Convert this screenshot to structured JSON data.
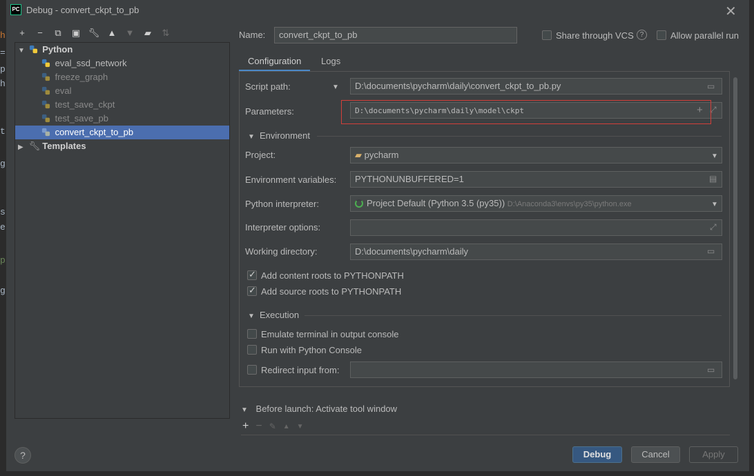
{
  "window": {
    "title": "Debug - convert_ckpt_to_pb",
    "logo_text": "PC"
  },
  "toolbar": {
    "icons": [
      "add-icon",
      "remove-icon",
      "copy-icon",
      "save-icon",
      "wrench-icon",
      "move-up-icon",
      "move-down-icon",
      "folder-icon",
      "sort-icon"
    ]
  },
  "tree": {
    "python_label": "Python",
    "items": [
      "eval_ssd_network",
      "freeze_graph",
      "eval",
      "test_save_ckpt",
      "test_save_pb",
      "convert_ckpt_to_pb"
    ],
    "templates_label": "Templates"
  },
  "name": {
    "label": "Name:",
    "value": "convert_ckpt_to_pb"
  },
  "share_vcs": {
    "label": "Share through VCS",
    "checked": false
  },
  "allow_parallel": {
    "label": "Allow parallel run",
    "checked": false
  },
  "tabs": [
    "Configuration",
    "Logs"
  ],
  "config": {
    "script_path_label": "Script path:",
    "script_path_value": "D:\\documents\\pycharm\\daily\\convert_ckpt_to_pb.py",
    "parameters_label": "Parameters:",
    "parameters_value": "D:\\documents\\pycharm\\daily\\model\\ckpt",
    "environment_label": "Environment",
    "project_label": "Project:",
    "project_value": "pycharm",
    "env_vars_label": "Environment variables:",
    "env_vars_value": "PYTHONUNBUFFERED=1",
    "interpreter_label": "Python interpreter:",
    "interpreter_value": "Project Default (Python 3.5 (py35))",
    "interpreter_path": "D:\\Anaconda3\\envs\\py35\\python.exe",
    "interp_options_label": "Interpreter options:",
    "interp_options_value": "",
    "working_dir_label": "Working directory:",
    "working_dir_value": "D:\\documents\\pycharm\\daily",
    "content_roots_label": "Add content roots to PYTHONPATH",
    "source_roots_label": "Add source roots to PYTHONPATH",
    "execution_label": "Execution",
    "emulate_terminal_label": "Emulate terminal in output console",
    "python_console_label": "Run with Python Console",
    "redirect_input_label": "Redirect input from:",
    "redirect_input_value": ""
  },
  "before_launch": {
    "label": "Before launch: Activate tool window"
  },
  "buttons": {
    "debug": "Debug",
    "cancel": "Cancel",
    "apply": "Apply",
    "help": "?"
  },
  "colors": {
    "accent": "#4b6eaf",
    "primary_button": "#365880",
    "highlight_border": "#d43f3a",
    "tab_underline": "#4a88c7"
  }
}
